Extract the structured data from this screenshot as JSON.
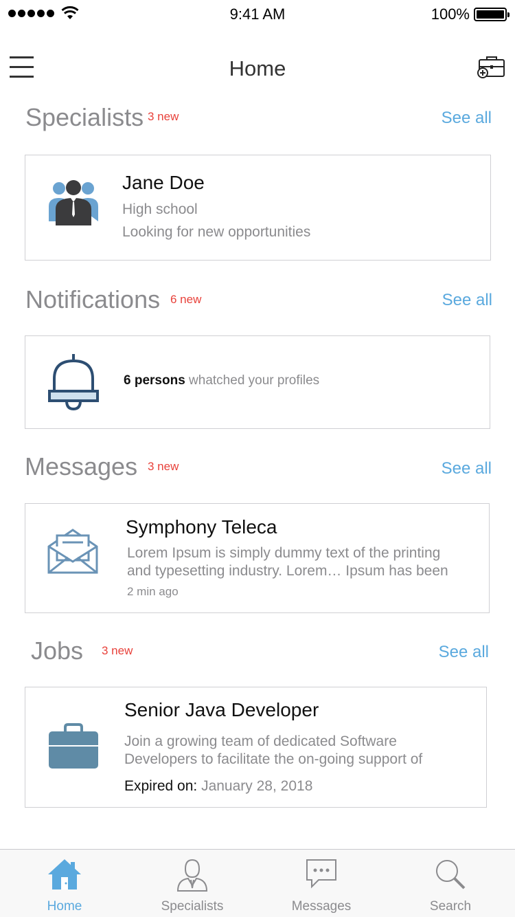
{
  "status_bar": {
    "time": "9:41 AM",
    "battery": "100%"
  },
  "header": {
    "title": "Home",
    "menu_icon": "hamburger-menu-icon",
    "action_icon": "briefcase-add-icon"
  },
  "specialists": {
    "title": "Specialists",
    "badge": "3 new",
    "see_all": "See all",
    "item": {
      "name": "Jane Doe",
      "education": "High school",
      "status": "Looking for new opportunities",
      "icon": "team-people-icon"
    }
  },
  "notifications": {
    "title": "Notifications",
    "badge": "6 new",
    "see_all": "See all",
    "item": {
      "count_text": "6 persons",
      "message": "whatched your profiles",
      "icon": "bell-icon"
    }
  },
  "messages": {
    "title": "Messages",
    "badge": "3 new",
    "see_all": "See all",
    "item": {
      "sender": "Symphony Teleca",
      "preview_line1": "Lorem Ipsum is simply dummy text of the printing",
      "preview_line2": "and typesetting industry. Lorem… Ipsum has been",
      "time": "2 min ago",
      "icon": "open-envelope-icon"
    }
  },
  "jobs": {
    "title": "Jobs",
    "badge": "3 new",
    "see_all": "See all",
    "item": {
      "title": "Senior Java Developer",
      "desc_line1": "Join a growing team of dedicated Software",
      "desc_line2": "Developers to facilitate the on-going support of",
      "expired_label": "Expired on:",
      "expired_date": "January 28, 2018",
      "icon": "briefcase-icon"
    }
  },
  "tabbar": {
    "tabs": [
      {
        "label": "Home",
        "icon": "home-icon",
        "active": true
      },
      {
        "label": "Specialists",
        "icon": "person-icon",
        "active": false
      },
      {
        "label": "Messages",
        "icon": "chat-bubble-icon",
        "active": false
      },
      {
        "label": "Search",
        "icon": "search-icon",
        "active": false
      }
    ]
  },
  "colors": {
    "accent": "#5aa9de",
    "badge": "#e8413a",
    "muted_text": "#8b8b8e",
    "icon_blue": "#5f8ba6"
  }
}
